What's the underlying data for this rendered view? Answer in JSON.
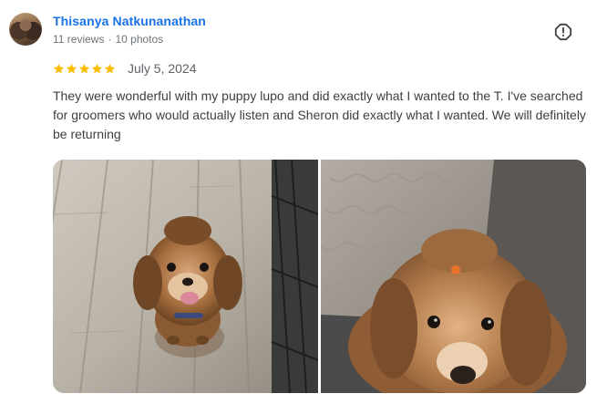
{
  "review": {
    "author": {
      "name": "Thisanya Natkunanathan",
      "reviews": "11 reviews",
      "photos": "10 photos",
      "separator": "·"
    },
    "rating": 5,
    "date": "July 5, 2024",
    "text": "They were wonderful with my puppy lupo and did exactly what I wanted to the T. I've searched for groomers who would actually listen and Sheron did exactly what I wanted. We will definitely be returning",
    "icons": {
      "report": "report-icon",
      "star": "star-icon",
      "avatar": "avatar"
    },
    "colors": {
      "author_name": "#1a73e8",
      "star": "#fbbc04",
      "meta": "#70757a"
    }
  }
}
